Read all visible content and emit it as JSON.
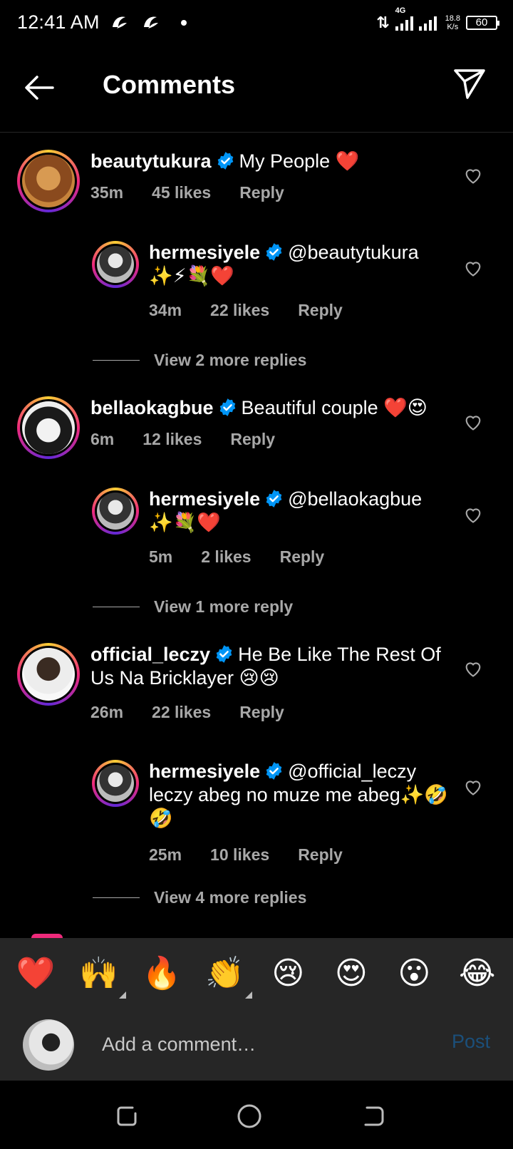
{
  "status_bar": {
    "time": "12:41 AM",
    "network_type": "4G",
    "speed_value": "18.8",
    "speed_unit": "K/s",
    "battery": "60"
  },
  "header": {
    "title": "Comments"
  },
  "comments": [
    {
      "username": "beautytukura",
      "text": "My People ❤️",
      "time": "35m",
      "likes": "45 likes",
      "reply_label": "Reply",
      "replies": [
        {
          "username": "hermesiyele",
          "text": "@beautytukura ✨⚡💐❤️",
          "time": "34m",
          "likes": "22 likes",
          "reply_label": "Reply"
        }
      ],
      "view_more": "View 2 more replies"
    },
    {
      "username": "bellaokagbue",
      "text": "Beautiful couple ❤️😍",
      "time": "6m",
      "likes": "12 likes",
      "reply_label": "Reply",
      "replies": [
        {
          "username": "hermesiyele",
          "text": "@bellaokagbue ✨💐❤️",
          "time": "5m",
          "likes": "2 likes",
          "reply_label": "Reply"
        }
      ],
      "view_more": "View 1 more reply"
    },
    {
      "username": "official_leczy",
      "text": "He Be Like The Rest Of Us Na Bricklayer 😢😢",
      "time": "26m",
      "likes": "22 likes",
      "reply_label": "Reply",
      "replies": [
        {
          "username": "hermesiyele",
          "text": "@official_leczy leczy abeg no muze me abeg✨🤣🤣",
          "time": "25m",
          "likes": "10 likes",
          "reply_label": "Reply"
        }
      ],
      "view_more": "View 4 more replies"
    }
  ],
  "emoji_bar": [
    "❤️",
    "🙌",
    "🔥",
    "👏",
    "😢",
    "😍",
    "😮",
    "😂"
  ],
  "composer": {
    "placeholder": "Add a comment…",
    "post_label": "Post"
  },
  "colors": {
    "background": "#000000",
    "secondary_text": "#a8a8a8",
    "verified_blue": "#0095f6",
    "panel": "#262626",
    "post_disabled": "#1b4f7a"
  }
}
